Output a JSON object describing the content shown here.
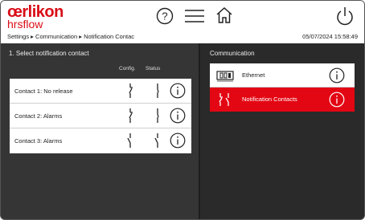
{
  "header": {
    "brand": "œrlikon",
    "sub_brand": "hrsflow",
    "breadcrumb": "Settings ▸ Communication ▸ Notification Contac",
    "datetime": "05/07/2024 15:58:49"
  },
  "left_panel": {
    "title": "1. Select notification contact",
    "col_config": "Config.",
    "col_status": "Status",
    "contacts": [
      {
        "label": "Contact 1: No release"
      },
      {
        "label": "Contact 2: Alarms"
      },
      {
        "label": "Contact 3: Alarms"
      }
    ]
  },
  "right_panel": {
    "title": "Communication",
    "items": [
      {
        "label": "Ethernet",
        "icon": "ethernet-icon",
        "active": false
      },
      {
        "label": "Notification Contacts",
        "icon": "contact-switch-icon",
        "active": true
      }
    ]
  },
  "colors": {
    "brand_red": "#d90d16",
    "active_red": "#e30613",
    "dark_bg": "#323232"
  }
}
